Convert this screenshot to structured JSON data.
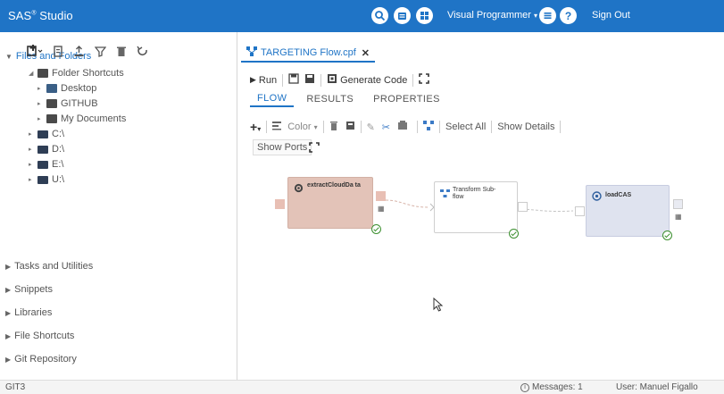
{
  "app": {
    "brand": "SAS",
    "brand_sup": "®",
    "brand_suffix": " Studio",
    "perspective": "Visual Programmer",
    "sign_out": "Sign Out"
  },
  "left": {
    "files_folders": "Files and Folders",
    "tree": [
      {
        "label": "Folder Shortcuts",
        "icon": "folder-shortcut-icon"
      },
      {
        "label": "Desktop",
        "icon": "desktop-icon"
      },
      {
        "label": "GITHUB",
        "icon": "folder-icon"
      },
      {
        "label": "My Documents",
        "icon": "documents-icon"
      },
      {
        "label": "C:\\",
        "icon": "drive-icon"
      },
      {
        "label": "D:\\",
        "icon": "drive-icon"
      },
      {
        "label": "E:\\",
        "icon": "drive-icon"
      },
      {
        "label": "U:\\",
        "icon": "drive-icon"
      }
    ],
    "sections": [
      "Tasks and Utilities",
      "Snippets",
      "Libraries",
      "File Shortcuts",
      "Git Repository"
    ]
  },
  "editor": {
    "tab_title": "TARGETING Flow.cpf",
    "run": "Run",
    "generate_code": "Generate Code",
    "subtabs": [
      "FLOW",
      "RESULTS",
      "PROPERTIES"
    ],
    "color": "Color",
    "select_all": "Select All",
    "show_details": "Show Details",
    "show_ports": "Show Ports"
  },
  "nodes": {
    "extract_title": "extractCloudDa ta",
    "transform_title": "Transform Sub-flow",
    "load_title": "loadCAS"
  },
  "status": {
    "left": "GIT3",
    "messages": "Messages: 1",
    "user": "User: Manuel Figallo"
  },
  "colors": {
    "topbar": "#1f74c6",
    "extract_node": "#e3c3b8",
    "load_node": "#dfe3ef",
    "success": "#3b8f2e"
  }
}
